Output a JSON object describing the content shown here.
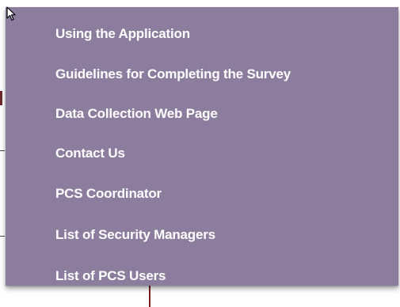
{
  "menu": {
    "items": [
      {
        "label": "Using the Application"
      },
      {
        "label": "Guidelines for Completing the Survey"
      },
      {
        "label": "Data Collection Web Page"
      },
      {
        "label": "Contact Us"
      },
      {
        "label": "PCS Coordinator"
      },
      {
        "label": "List of Security Managers"
      },
      {
        "label": "List of PCS Users"
      }
    ],
    "background_color": "#8c7d9e",
    "text_color": "#ffffff"
  },
  "cursor": {
    "icon": "mouse-pointer-icon"
  }
}
